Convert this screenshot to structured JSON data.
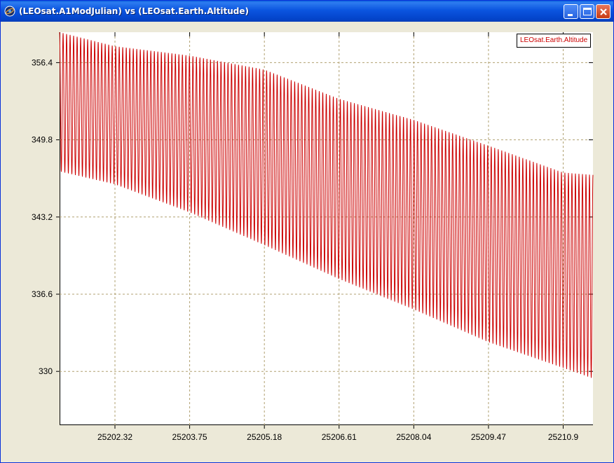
{
  "window": {
    "title": "(LEOsat.A1ModJulian) vs (LEOsat.Earth.Altitude)",
    "buttons": [
      "minimize",
      "maximize",
      "close"
    ]
  },
  "colors": {
    "series": "#CC0000",
    "grid": "#B0A070",
    "titlebar": "#0A5FDB"
  },
  "chart_data": {
    "type": "line",
    "title": "",
    "xlabel": "",
    "ylabel": "",
    "xlim": [
      25201.26,
      25211.47
    ],
    "ylim": [
      325.4,
      359.0
    ],
    "x_ticks": [
      25202.32,
      25203.75,
      25205.18,
      25206.61,
      25208.04,
      25209.47,
      25210.9
    ],
    "x_tick_labels": [
      "25202.32",
      "25203.75",
      "25205.18",
      "25206.61",
      "25208.04",
      "25209.47",
      "25210.9"
    ],
    "y_ticks": [
      330,
      336.6,
      343.2,
      349.8,
      356.4
    ],
    "y_tick_labels": [
      "330",
      "336.6",
      "343.2",
      "349.8",
      "356.4"
    ],
    "grid": true,
    "legend_position": "top-right",
    "series": [
      {
        "name": "LEOsat.Earth.Altitude",
        "color": "#CC0000",
        "x_start": 25201.26,
        "x_end": 25211.47,
        "oscillations": 152,
        "upper_envelope": [
          [
            25201.26,
            359.0
          ],
          [
            25202.32,
            357.8
          ],
          [
            25203.75,
            357.0
          ],
          [
            25205.18,
            355.8
          ],
          [
            25206.61,
            353.3
          ],
          [
            25208.04,
            351.5
          ],
          [
            25209.47,
            349.3
          ],
          [
            25210.9,
            347.0
          ],
          [
            25211.47,
            346.8
          ]
        ],
        "lower_envelope": [
          [
            25201.26,
            347.1
          ],
          [
            25202.32,
            346.0
          ],
          [
            25203.75,
            343.6
          ],
          [
            25205.18,
            340.8
          ],
          [
            25206.61,
            337.9
          ],
          [
            25208.04,
            335.3
          ],
          [
            25209.47,
            332.5
          ],
          [
            25210.9,
            330.3
          ],
          [
            25211.47,
            329.4
          ]
        ]
      }
    ]
  }
}
